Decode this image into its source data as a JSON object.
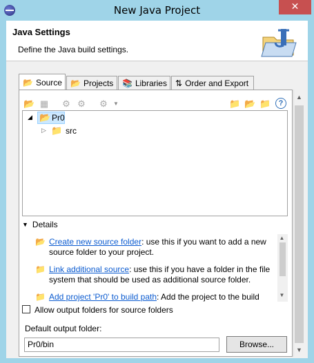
{
  "window": {
    "title": "New Java Project",
    "close_glyph": "✕"
  },
  "banner": {
    "title": "Java Settings",
    "description": "Define the Java build settings."
  },
  "tabs": [
    {
      "label": "Source",
      "icon": "source-folder-icon",
      "active": true
    },
    {
      "label": "Projects",
      "icon": "projects-icon",
      "active": false
    },
    {
      "label": "Libraries",
      "icon": "libraries-icon",
      "active": false
    },
    {
      "label": "Order and Export",
      "icon": "order-export-icon",
      "active": false
    }
  ],
  "tree": {
    "root": {
      "label": "Pr0",
      "expanded": true,
      "selected": true
    },
    "children": [
      {
        "label": "src",
        "expanded": false
      }
    ]
  },
  "details": {
    "label": "Details",
    "items": [
      {
        "link": "Create new source folder",
        "text": ": use this if you want to add a new source folder to your project."
      },
      {
        "link": "Link additional source",
        "text": ": use this if you have a folder in the file system that should be used as additional source folder."
      },
      {
        "link": "Add project 'Pr0' to build path",
        "text": ": Add the project to the build"
      }
    ]
  },
  "allow_output_folders": {
    "label": "Allow output folders for source folders",
    "checked": false
  },
  "default_output": {
    "label": "Default output folder:",
    "value": "Pr0/bin"
  },
  "browse_button": {
    "label": "Browse..."
  },
  "colors": {
    "title_bar": "#9fd4e8",
    "close": "#c75050",
    "link": "#0b5bd0",
    "selection": "#cce8ff"
  }
}
